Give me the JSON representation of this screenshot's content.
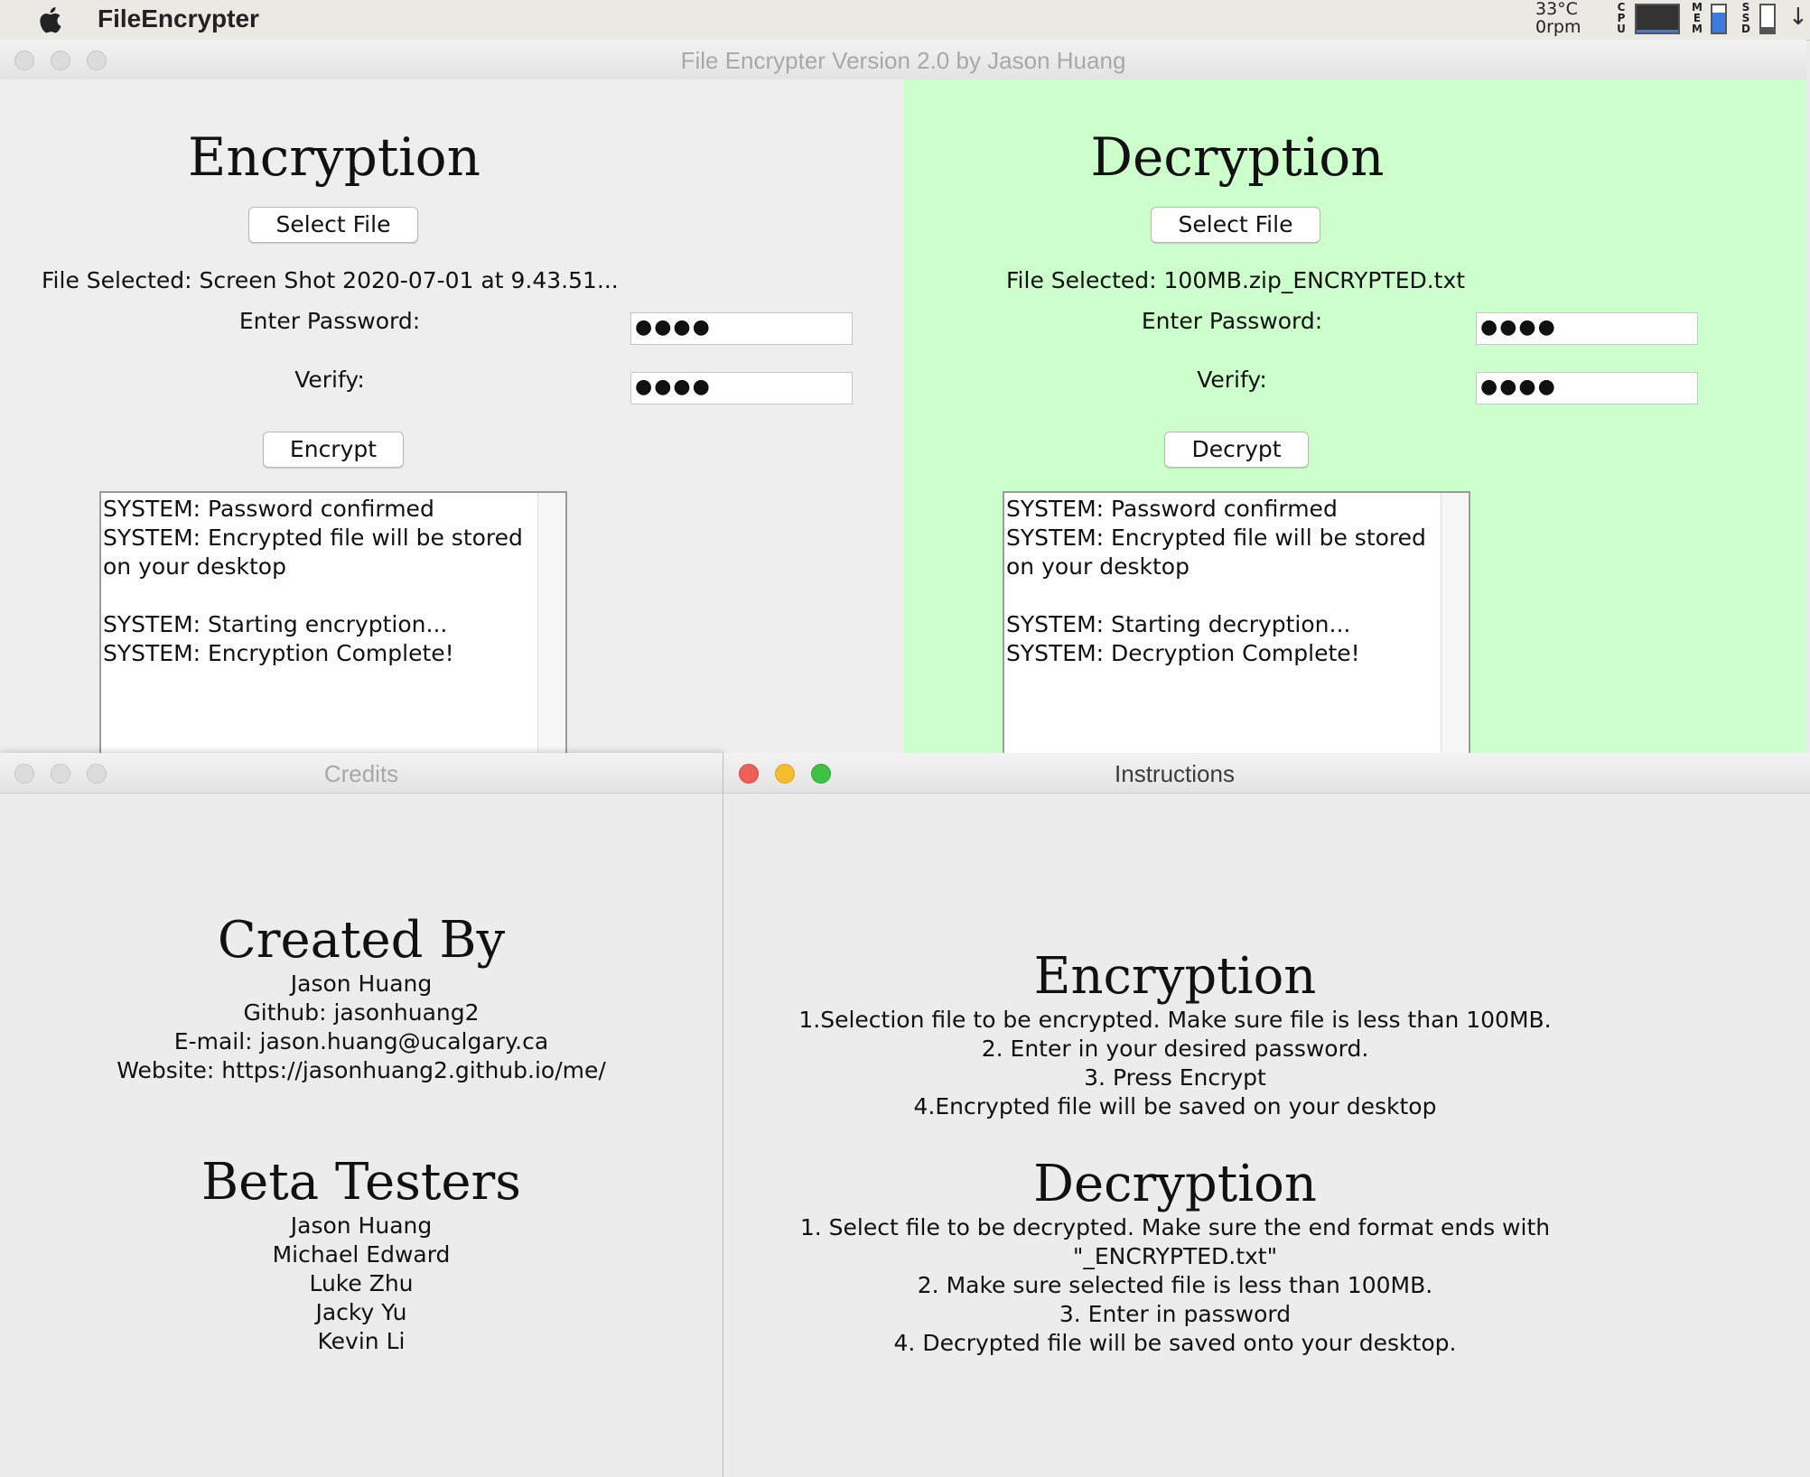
{
  "menubar": {
    "app_name": "FileEncrypter",
    "temperature": "33°C",
    "fan": "0rpm",
    "cpu_label": "CPU",
    "mem_label": "MEM",
    "ssd_label": "SSD",
    "icons": [
      "apple-icon",
      "download-icon"
    ]
  },
  "main_window": {
    "title": "File Encrypter Version 2.0 by Jason Huang",
    "encryption": {
      "heading": "Encryption",
      "select_button": "Select File",
      "file_selected": "File Selected: Screen Shot 2020-07-01 at 9.43.51...",
      "password_label": "Enter Password:",
      "password_value": "●●●●",
      "verify_label": "Verify:",
      "verify_value": "●●●●",
      "action_button": "Encrypt",
      "log": "SYSTEM: Password confirmed\nSYSTEM: Encrypted file will be stored\non your desktop\n\nSYSTEM: Starting encryption...\nSYSTEM: Encryption Complete!"
    },
    "decryption": {
      "heading": "Decryption",
      "select_button": "Select File",
      "file_selected": "File Selected: 100MB.zip_ENCRYPTED.txt",
      "password_label": "Enter Password:",
      "password_value": "●●●●",
      "verify_label": "Verify:",
      "verify_value": "●●●●",
      "action_button": "Decrypt",
      "log": "SYSTEM: Password confirmed\nSYSTEM: Encrypted file will be stored\non your desktop\n\nSYSTEM: Starting decryption...\nSYSTEM: Decryption Complete!"
    },
    "colors": {
      "decryption_bg": "#ccffcc",
      "encryption_bg": "#eeeeee"
    }
  },
  "credits_window": {
    "title": "Credits",
    "created_heading": "Created By",
    "created_lines": [
      "Jason Huang",
      "Github: jasonhuang2",
      "E-mail: jason.huang@ucalgary.ca",
      "Website: https://jasonhuang2.github.io/me/"
    ],
    "testers_heading": "Beta Testers",
    "testers": [
      "Jason Huang",
      "Michael Edward",
      "Luke Zhu",
      "Jacky Yu",
      "Kevin Li"
    ]
  },
  "instructions_window": {
    "title": "Instructions",
    "enc_heading": "Encryption",
    "enc_lines": [
      "1.Selection file to be encrypted. Make sure file is less than 100MB.",
      "2. Enter in your desired password.",
      "3. Press Encrypt",
      "4.Encrypted file will be saved on your desktop"
    ],
    "dec_heading": "Decryption",
    "dec_lines": [
      "1. Select file to be decrypted. Make sure the end format ends with \"_ENCRYPTED.txt\"",
      "2. Make sure selected file is less than 100MB.",
      "3. Enter in password",
      "4. Decrypted file will be saved onto your desktop."
    ]
  }
}
